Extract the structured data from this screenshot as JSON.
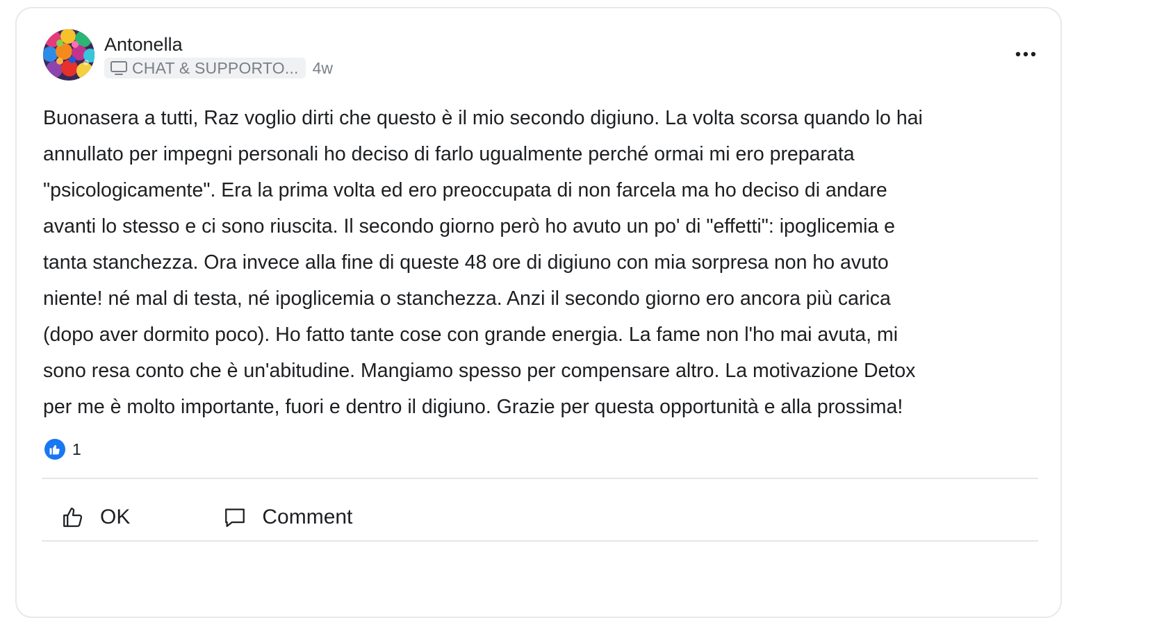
{
  "post": {
    "author": "Antonella",
    "group_label": "CHAT & SUPPORTO...",
    "group_icon": "monitor-icon",
    "time_ago": "4w",
    "menu_icon": "more-horizontal-icon",
    "body": "Buonasera a tutti, Raz voglio dirti che questo è il mio secondo digiuno. La volta scorsa quando lo hai\nannullato per impegni personali ho deciso di farlo ugualmente perché ormai mi ero preparata\n\"psicologicamente\". Era la prima volta ed ero preoccupata di non farcela ma ho deciso di andare\navanti lo stesso e ci sono riuscita. Il secondo giorno però ho avuto un po' di \"effetti\": ipoglicemia e\ntanta stanchezza. Ora invece alla fine di queste 48 ore di digiuno con mia sorpresa non ho avuto\nniente! né mal di testa, né ipoglicemia o stanchezza. Anzi il secondo giorno ero ancora più carica\n(dopo aver dormito poco). Ho fatto tante cose con grande energia. La fame non l'ho mai avuta, mi\nsono resa conto che è un'abitudine. Mangiamo spesso per compensare altro. La motivazione Detox\nper me è molto importante, fuori e dentro il digiuno. Grazie per questa opportunità e alla prossima!"
  },
  "reactions": {
    "icon": "thumbs-up-icon",
    "count": "1",
    "color": "#1877f2"
  },
  "actions": {
    "like_label": "OK",
    "like_icon": "thumbs-up-outline-icon",
    "comment_label": "Comment",
    "comment_icon": "comment-bubble-icon"
  }
}
